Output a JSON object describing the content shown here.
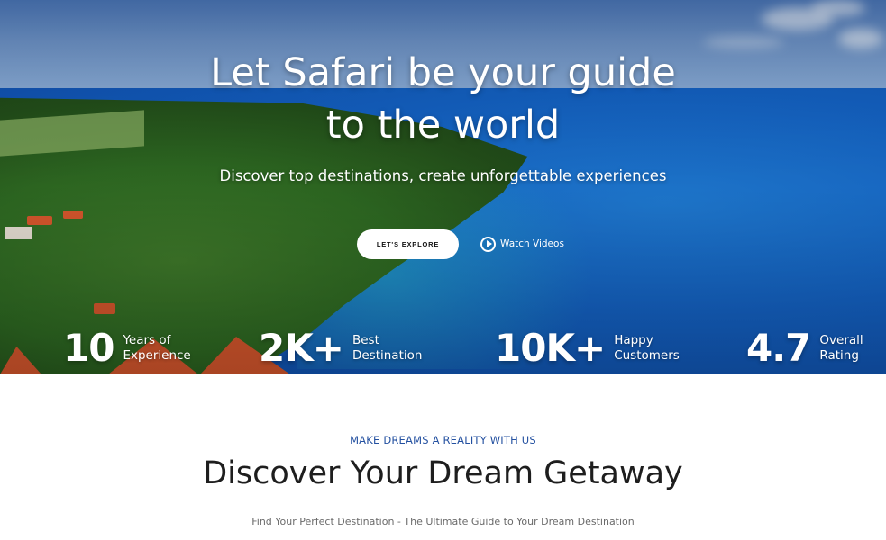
{
  "hero": {
    "title_line1": "Let Safari be your guide",
    "title_line2": "to the world",
    "subtitle": "Discover top destinations, create unforgettable experiences",
    "explore_label": "LET'S EXPLORE",
    "watch_label": "Watch Videos",
    "play_icon": "play-circle-icon"
  },
  "stats": [
    {
      "value": "10",
      "label_line1": "Years of",
      "label_line2": "Experience"
    },
    {
      "value": "2K+",
      "label_line1": "Best",
      "label_line2": "Destination"
    },
    {
      "value": "10K+",
      "label_line1": "Happy",
      "label_line2": "Customers"
    },
    {
      "value": "4.7",
      "label_line1": "Overall",
      "label_line2": "Rating"
    }
  ],
  "section": {
    "eyebrow": "MAKE DREAMS A REALITY WITH US",
    "title": "Discover Your Dream Getaway",
    "subtitle": "Find Your Perfect Destination - The Ultimate Guide to Your Dream Destination"
  },
  "colors": {
    "accent_blue": "#2350a0",
    "hero_text": "#ffffff",
    "title_text": "#1e1e1e"
  }
}
